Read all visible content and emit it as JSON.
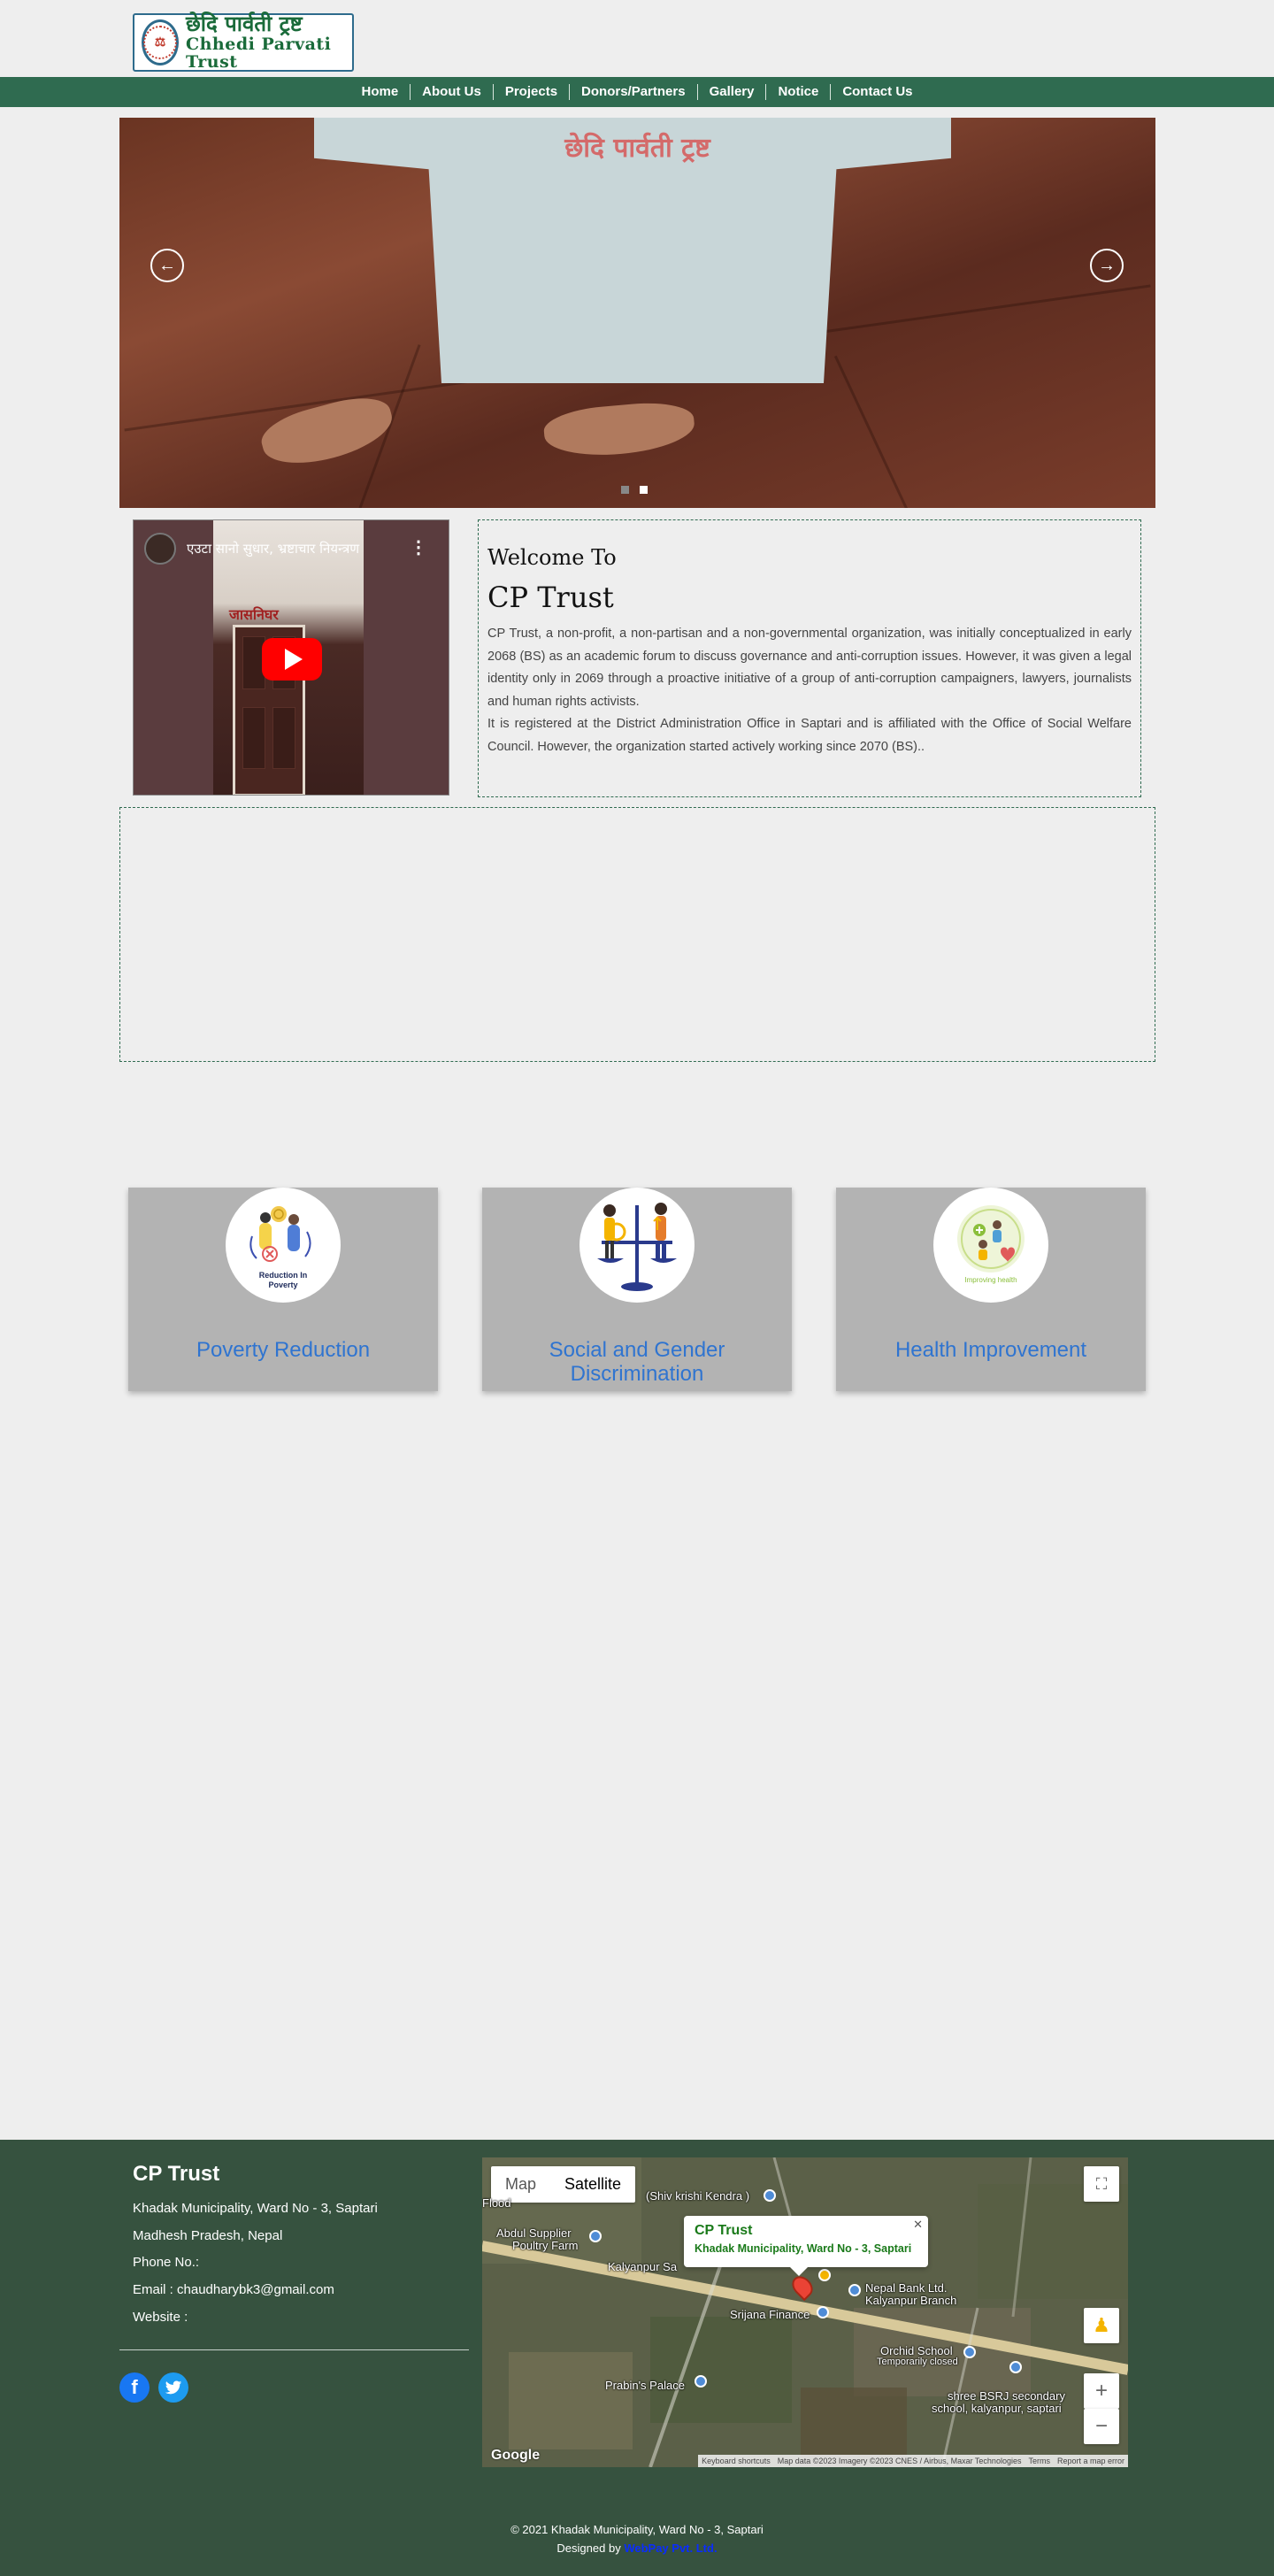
{
  "logo": {
    "devanagari": "छेदि पार्वती ट्रष्ट",
    "english": "Chhedi Parvati Trust"
  },
  "nav": {
    "items": [
      "Home",
      "About Us",
      "Projects",
      "Donors/Partners",
      "Gallery",
      "Notice",
      "Contact Us"
    ]
  },
  "slider": {
    "shirt_heading": "छेदि पार्वती ट्रष्ट",
    "prev_glyph": "←",
    "next_glyph": "→",
    "active_slide": 2,
    "slide_count": 2
  },
  "video": {
    "title": "एउटा सानो सुधार, भ्रष्टाचार नियन्त्रण",
    "wall_text": "जासनिघर"
  },
  "welcome": {
    "subheading": "Welcome To",
    "heading": "CP Trust",
    "para1": "CP Trust, a non-profit, a non-partisan and a non-governmental organization, was initially conceptualized in early 2068 (BS) as an academic forum to discuss governance and anti-corruption issues. However, it was given a legal identity only in 2069 through a proactive initiative of a group of anti-corruption campaigners, lawyers, journalists and human rights activists.",
    "para2": "It is registered at the District Administration Office in Saptari and is affiliated with the Office of Social Welfare Council. However, the organization started actively working since 2070 (BS).."
  },
  "cards": [
    {
      "title": "Poverty Reduction",
      "icon_caption": "Reduction In Poverty"
    },
    {
      "title": "Social and Gender Discrimination",
      "icon_caption": ""
    },
    {
      "title": "Health Improvement",
      "icon_caption": "Improving health"
    }
  ],
  "footer": {
    "title": "CP Trust",
    "address1": "Khadak Municipality, Ward No - 3, Saptari",
    "address2": "Madhesh Pradesh, Nepal",
    "phone": "Phone No.:",
    "email": "Email : chaudharybk3@gmail.com",
    "website": "Website :",
    "copyright": "© 2021 Khadak Municipality, Ward No - 3, Saptari",
    "designed_by": "Designed by",
    "designer": "WebPay Pvt. Ltd."
  },
  "map": {
    "tab_map": "Map",
    "tab_satellite": "Satellite",
    "active_tab": "Satellite",
    "info_title": "CP Trust",
    "info_address": "Khadak Municipality, Ward No - 3, Saptari",
    "labels": {
      "krishi": "(Shiv krishi Kendra )",
      "flood": "Flood",
      "abdul1": "Abdul Supplier",
      "abdul2": "Poultry Farm",
      "kalyanpur": "Kalyanpur Sa",
      "nepal_bank1": "Nepal Bank Ltd.",
      "nepal_bank2": "Kalyanpur Branch",
      "srijana": "Srijana Finance",
      "orchid": "Orchid School",
      "orchid_status": "Temporarily closed",
      "prabin": "Prabin's Palace",
      "bsrj1": "shree BSRJ secondary",
      "bsrj2": "school, kalyanpur, saptari"
    },
    "attribution": [
      "Keyboard shortcuts",
      "Map data ©2023 Imagery ©2023 CNES / Airbus, Maxar Technologies",
      "Terms",
      "Report a map error"
    ],
    "google": "Google",
    "zoom_in": "+",
    "zoom_out": "−"
  },
  "colors": {
    "nav_bg": "#2f6b50",
    "footer_bg": "#36523f",
    "card_bg": "#b3b3b3",
    "card_title": "#2f74d0",
    "designer_link": "#0a2cff"
  }
}
